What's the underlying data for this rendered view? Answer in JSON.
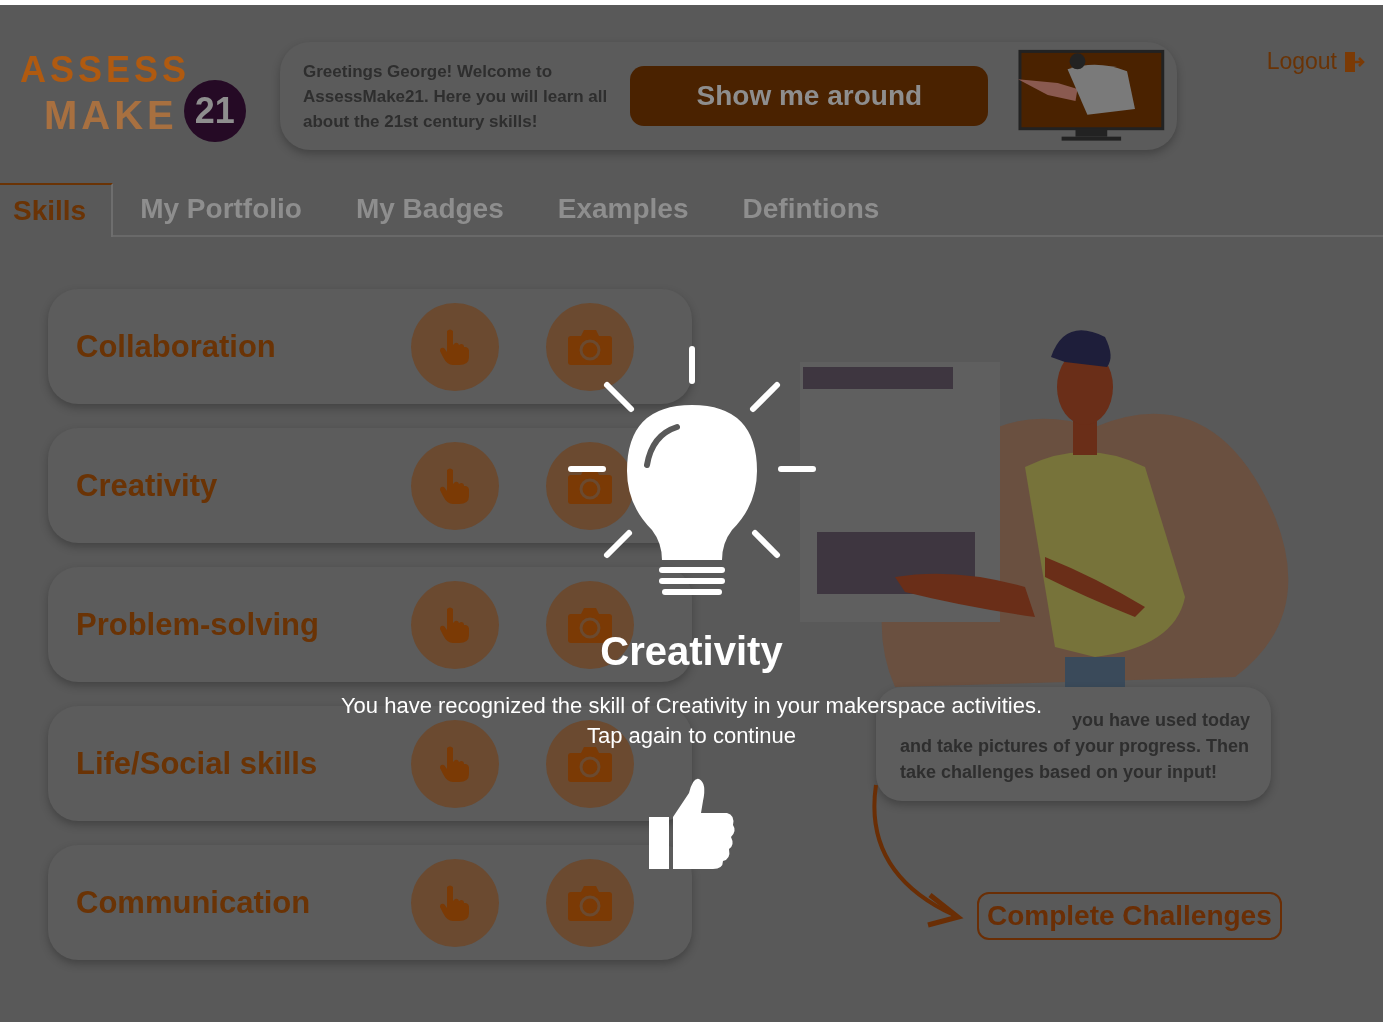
{
  "logo": {
    "word_top": "ASSESS",
    "word_bottom": "MAKE",
    "badge": "21"
  },
  "greeting": {
    "text": "Greetings George! Welcome to AssessMake21. Here you will learn all about the 21st century skills!",
    "button": "Show me around"
  },
  "logout": "Logout",
  "tabs": [
    {
      "label": "Skills",
      "selected": true
    },
    {
      "label": "My Portfolio",
      "selected": false
    },
    {
      "label": "My Badges",
      "selected": false
    },
    {
      "label": "Examples",
      "selected": false
    },
    {
      "label": "Defintions",
      "selected": false
    }
  ],
  "skills": [
    "Collaboration",
    "Creativity",
    "Problem-solving",
    "Life/Social skills",
    "Communication"
  ],
  "info_card": {
    "lines": [
      "you have used today",
      "and take pictures of your progress. Then",
      "take challenges based on your input!"
    ]
  },
  "challenge_button": "Complete Challenges",
  "popup": {
    "title": "Creativity",
    "message": "You have recognized the skill of Creativity in your makerspace activities.",
    "hint": "Tap again to continue"
  }
}
